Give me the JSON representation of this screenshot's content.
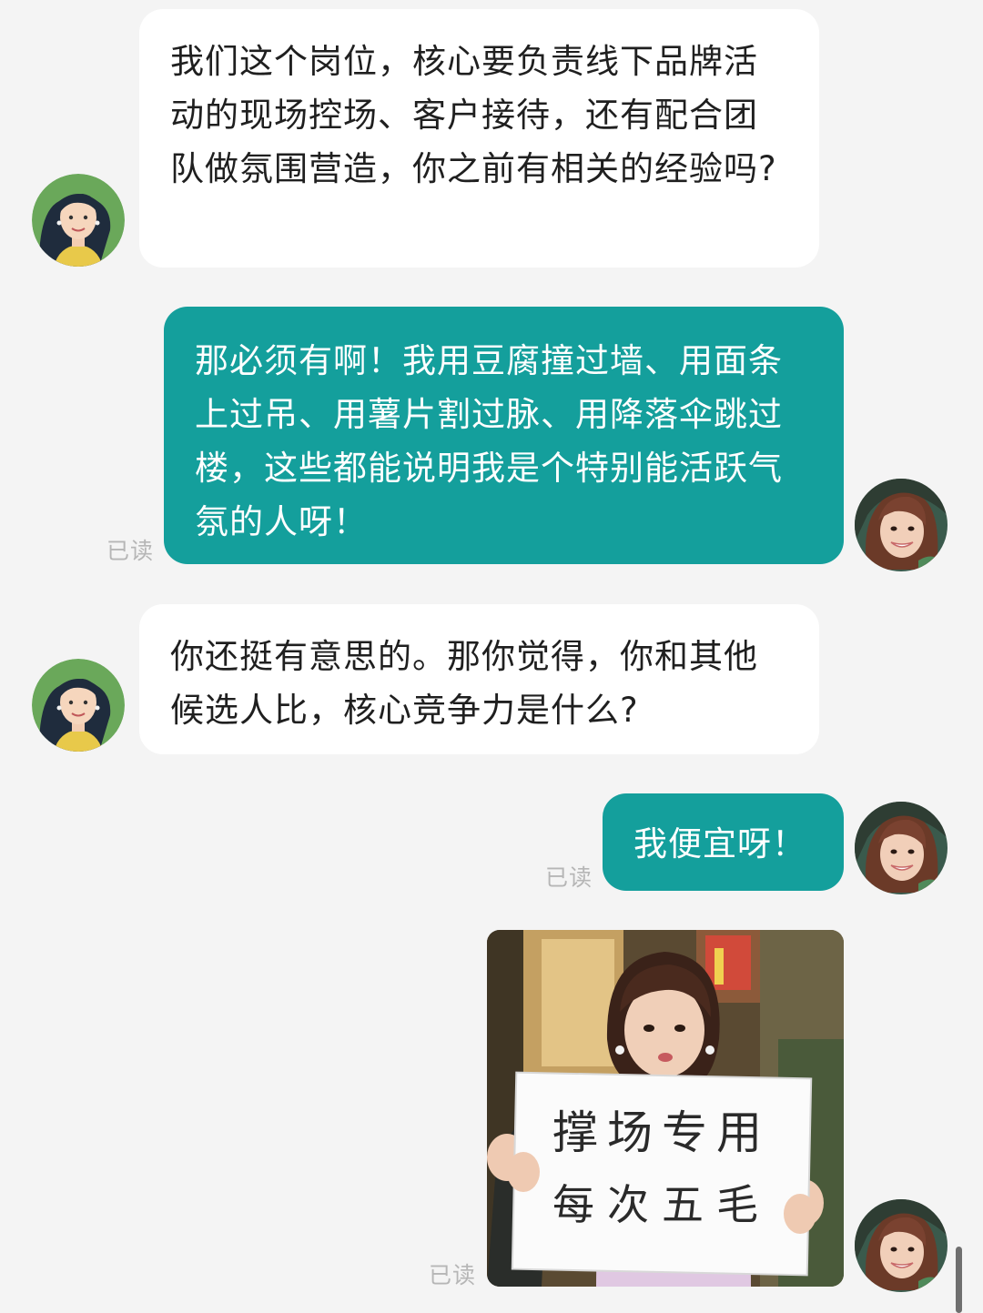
{
  "messages": [
    {
      "from": "interviewer",
      "text": "我们这个岗位，核心要负责线下品牌活动的现场控场、客户接待，还有配合团队做氛围营造，你之前有相关的经验吗?"
    },
    {
      "from": "me",
      "text": "那必须有啊！我用豆腐撞过墙、用面条上过吊、用薯片割过脉、用降落伞跳过楼，这些都能说明我是个特别能活跃气氛的人呀！",
      "status": "已读"
    },
    {
      "from": "interviewer",
      "text": "你还挺有意思的。那你觉得，你和其他候选人比，核心竞争力是什么?"
    },
    {
      "from": "me",
      "text": "我便宜呀！",
      "status": "已读"
    },
    {
      "from": "me",
      "type": "image",
      "sign_line_1": "撑场专用",
      "sign_line_2": "每次五毛",
      "status": "已读"
    }
  ],
  "colors": {
    "background": "#f4f4f4",
    "incoming_bubble": "#ffffff",
    "outgoing_bubble": "#149f9c",
    "read_receipt": "#b6b6b6"
  }
}
